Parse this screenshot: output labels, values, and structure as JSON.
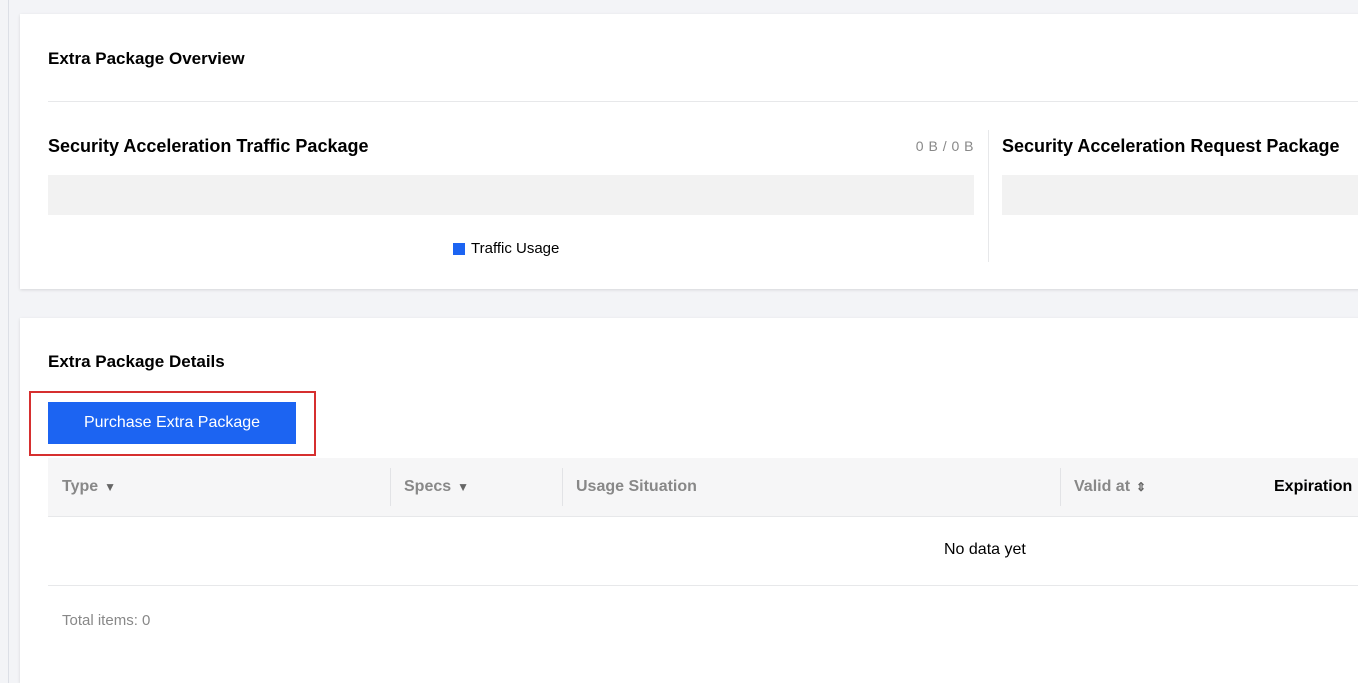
{
  "overview": {
    "title": "Extra Package Overview",
    "traffic_package": {
      "title": "Security Acceleration Traffic Package",
      "value": "0 B / 0 B",
      "usage_fraction": 0,
      "legend_label": "Traffic Usage",
      "legend_color": "#1c64f2"
    },
    "request_package": {
      "title": "Security Acceleration Request Package",
      "usage_fraction": 0
    }
  },
  "details": {
    "title": "Extra Package Details",
    "purchase_button_label": "Purchase Extra Package",
    "table": {
      "columns": [
        {
          "label": "Type",
          "icon": "filter-icon"
        },
        {
          "label": "Specs",
          "icon": "filter-icon"
        },
        {
          "label": "Usage Situation",
          "icon": ""
        },
        {
          "label": "Valid at",
          "icon": "sort-icon"
        },
        {
          "label": "Expiration",
          "icon": ""
        }
      ],
      "rows": [],
      "empty_text": "No data yet"
    },
    "total_items_label": "Total items: 0"
  },
  "colors": {
    "primary": "#1c64f2",
    "highlight": "#d62f2f"
  }
}
